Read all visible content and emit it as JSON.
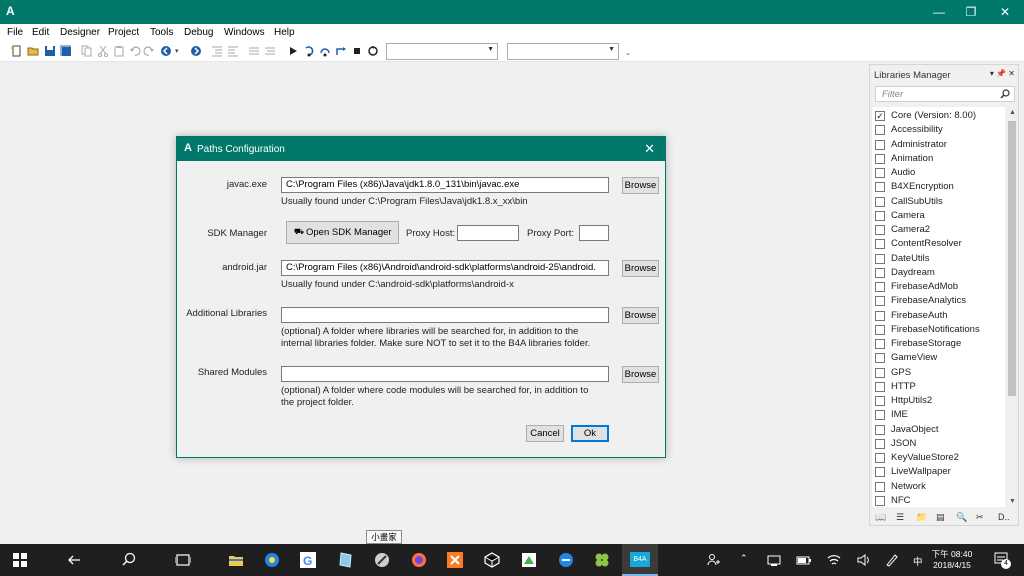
{
  "window": {
    "app_icon": "A",
    "minimize": "—",
    "restore": "❐",
    "close": "✕"
  },
  "menu": [
    "File",
    "Edit",
    "Designer",
    "Project",
    "Tools",
    "Debug",
    "Windows",
    "Help"
  ],
  "libraries_panel": {
    "title": "Libraries Manager",
    "filter_placeholder": "Filter",
    "items": [
      {
        "label": "Core (Version: 8.00)",
        "checked": true
      },
      {
        "label": "Accessibility",
        "checked": false
      },
      {
        "label": "Administrator",
        "checked": false
      },
      {
        "label": "Animation",
        "checked": false
      },
      {
        "label": "Audio",
        "checked": false
      },
      {
        "label": "B4XEncryption",
        "checked": false
      },
      {
        "label": "CallSubUtils",
        "checked": false
      },
      {
        "label": "Camera",
        "checked": false
      },
      {
        "label": "Camera2",
        "checked": false
      },
      {
        "label": "ContentResolver",
        "checked": false
      },
      {
        "label": "DateUtils",
        "checked": false
      },
      {
        "label": "Daydream",
        "checked": false
      },
      {
        "label": "FirebaseAdMob",
        "checked": false
      },
      {
        "label": "FirebaseAnalytics",
        "checked": false
      },
      {
        "label": "FirebaseAuth",
        "checked": false
      },
      {
        "label": "FirebaseNotifications",
        "checked": false
      },
      {
        "label": "FirebaseStorage",
        "checked": false
      },
      {
        "label": "GameView",
        "checked": false
      },
      {
        "label": "GPS",
        "checked": false
      },
      {
        "label": "HTTP",
        "checked": false
      },
      {
        "label": "HttpUtils2",
        "checked": false
      },
      {
        "label": "IME",
        "checked": false
      },
      {
        "label": "JavaObject",
        "checked": false
      },
      {
        "label": "JSON",
        "checked": false
      },
      {
        "label": "KeyValueStore2",
        "checked": false
      },
      {
        "label": "LiveWallpaper",
        "checked": false
      },
      {
        "label": "Network",
        "checked": false
      },
      {
        "label": "NFC",
        "checked": false
      }
    ],
    "bottom_tab_more": "D.."
  },
  "dialog": {
    "icon": "A",
    "title": "Paths Configuration",
    "close": "✕",
    "javac": {
      "label": "javac.exe",
      "value": "C:\\Program Files (x86)\\Java\\jdk1.8.0_131\\bin\\javac.exe",
      "hint": "Usually found under C:\\Program Files\\Java\\jdk1.8.x_xx\\bin",
      "browse": "Browse"
    },
    "sdk": {
      "label": "SDK Manager",
      "button": "Open SDK Manager",
      "proxy_host_label": "Proxy Host:",
      "proxy_host_value": "",
      "proxy_port_label": "Proxy Port:",
      "proxy_port_value": ""
    },
    "android_jar": {
      "label": "android.jar",
      "value": "C:\\Program Files (x86)\\Android\\android-sdk\\platforms\\android-25\\android.",
      "hint": "Usually found under C:\\android-sdk\\platforms\\android-x",
      "browse": "Browse"
    },
    "additional_libraries": {
      "label": "Additional Libraries",
      "value": "",
      "hint1": "(optional) A folder where libraries will be searched for, in addition to the",
      "hint2": "internal libraries folder. Make sure NOT to set it to the B4A libraries folder.",
      "browse": "Browse"
    },
    "shared_modules": {
      "label": "Shared Modules",
      "value": "",
      "hint1": "(optional) A folder where code modules will be searched for, in addition to",
      "hint2": "the project folder.",
      "browse": "Browse"
    },
    "cancel": "Cancel",
    "ok": "Ok"
  },
  "taskbar": {
    "tooltip": "小畫家",
    "b4a_label": "B4A",
    "ime": "中",
    "time": "下午 08:40",
    "date": "2018/4/15",
    "notifications": "4"
  }
}
